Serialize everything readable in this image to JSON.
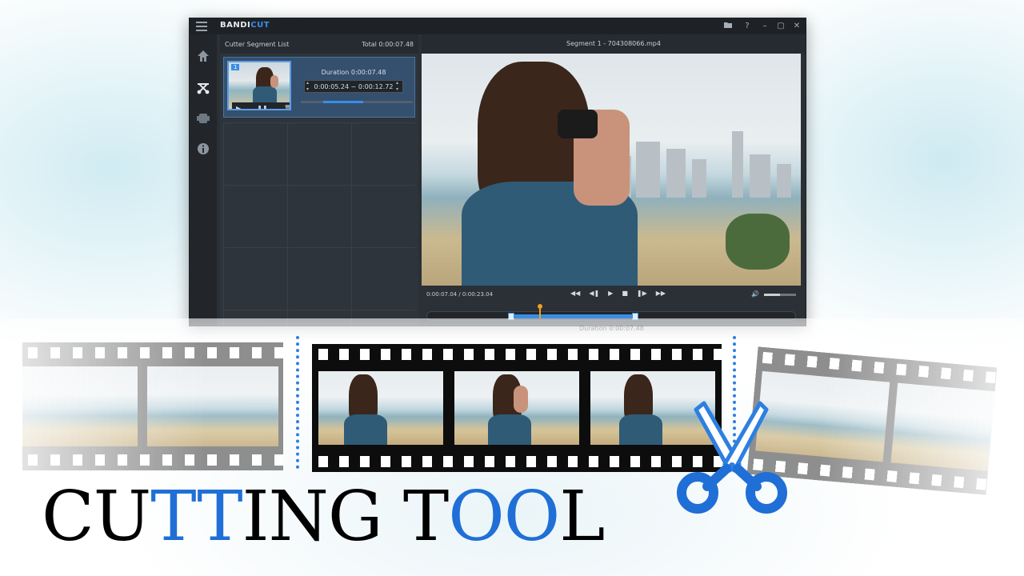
{
  "app": {
    "logo": {
      "part1": "BANDI",
      "part2": "CUT"
    },
    "window_controls": [
      "folder-icon",
      "help-icon",
      "minimize-icon",
      "maximize-icon",
      "close-icon"
    ],
    "sidebar_icons": [
      "home-icon",
      "cut-icon",
      "encode-icon",
      "info-icon"
    ],
    "segment_list": {
      "title": "Cutter Segment List",
      "total": "Total 0:00:07.48",
      "items": [
        {
          "number": "1",
          "duration": "Duration 0:00:07.48",
          "range": "0:00:05.24 ~ 0:00:12.72",
          "progress": 0.36
        }
      ]
    },
    "preview": {
      "title": "Segment 1 - 704308066.mp4",
      "time": "0:00:07.04 / 0:00:23.04",
      "controls": [
        "prev-segment-icon",
        "prev-frame-icon",
        "play-icon",
        "stop-icon",
        "next-frame-icon",
        "next-segment-icon"
      ],
      "volume": 0.5,
      "selection_start": 0.228,
      "selection_end": 0.562,
      "playhead": 0.306
    },
    "ghost_duration": "Duration 0:00:07.48"
  },
  "headline": {
    "part1": "CU",
    "part2": "TT",
    "part3": "ING T",
    "part4": "OO",
    "part5": "L"
  },
  "colors": {
    "accent": "#3a8ee6",
    "headline_blue": "#1f6fd6",
    "playhead": "#f0a020",
    "app_bg": "#2b3036"
  }
}
